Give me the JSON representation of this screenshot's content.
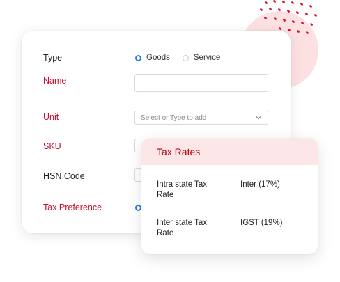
{
  "form": {
    "type_label": "Type",
    "type_options": [
      "Goods",
      "Service"
    ],
    "type_selected": "Goods",
    "name_label": "Name",
    "unit_label": "Unit",
    "unit_placeholder": "Select or Type to add",
    "sku_label": "SKU",
    "hsn_label": "HSN Code",
    "tax_pref_label": "Tax Preference"
  },
  "tax_rates": {
    "title": "Tax Rates",
    "rows": [
      {
        "name": "Intra state Tax Rate",
        "value": "Inter (17%)"
      },
      {
        "name": "Inter state Tax Rate",
        "value": "IGST (19%)"
      }
    ]
  },
  "colors": {
    "required_label": "#c8102e",
    "accent_blue": "#2f7be5",
    "header_bg": "#fde6e7",
    "decor_red": "#d4162a"
  }
}
